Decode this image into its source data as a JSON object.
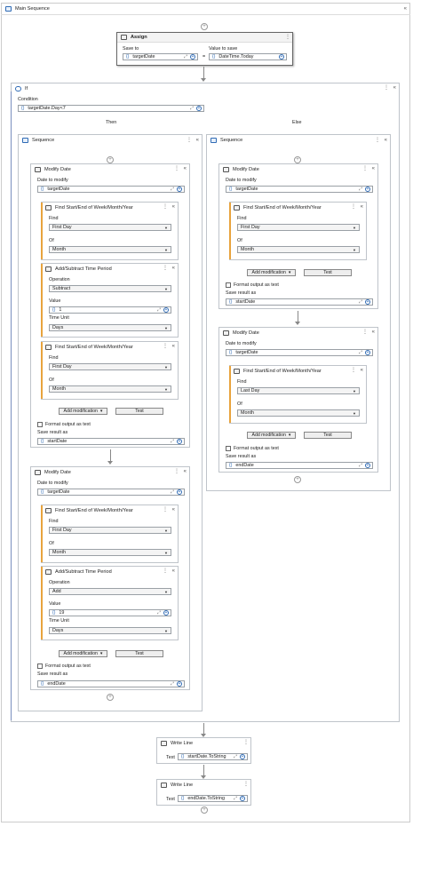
{
  "labels": {
    "main_sequence": "Main Sequence",
    "assign": "Assign",
    "save_to": "Save to",
    "value_to_save": "Value to save",
    "if": "If",
    "condition": "Condition",
    "then": "Then",
    "else": "Else",
    "sequence": "Sequence",
    "modify_date": "Modify Date",
    "date_to_modify": "Date to modify",
    "find_start_end": "Find Start/End of Week/Month/Year",
    "find": "Find",
    "of": "Of",
    "add_subtract": "Add/Subtract Time Period",
    "operation": "Operation",
    "value": "Value",
    "time_unit": "Time Unit",
    "add_modification": "Add modification",
    "test": "Test",
    "format_output": "Format output as text",
    "save_result_as": "Save result as",
    "write_line": "Write Line",
    "text": "Text"
  },
  "assign": {
    "save_to": "targetDate",
    "value": "DateTime.Today",
    "eq": "="
  },
  "if_block": {
    "condition": "targetDate.Day<7"
  },
  "then_seq": {
    "md1": {
      "date": "targetDate",
      "find": "First Day",
      "of": "Month",
      "operation": "Subtract",
      "value": "1",
      "unit": "Days",
      "find2": "First Day",
      "of2": "Month",
      "result": "startDate"
    },
    "md2": {
      "date": "targetDate",
      "find": "First Day",
      "of": "Month",
      "operation": "Add",
      "value": "19",
      "unit": "Days",
      "result": "endDate"
    }
  },
  "else_seq": {
    "md1": {
      "date": "targetDate",
      "find": "First Day",
      "of": "Month",
      "result": "startDate"
    },
    "md2": {
      "date": "targetDate",
      "find": "Last Day",
      "of": "Month",
      "result": "endDate"
    }
  },
  "write1": {
    "text": "startDate.ToString"
  },
  "write2": {
    "text": "endDate.ToString"
  },
  "glyphs": {
    "brace": "{}",
    "expand": "⤢",
    "plus": "+",
    "dots": "⋮",
    "chev": "«",
    "dropdown": "▼",
    "dd_arrow": "▾"
  }
}
